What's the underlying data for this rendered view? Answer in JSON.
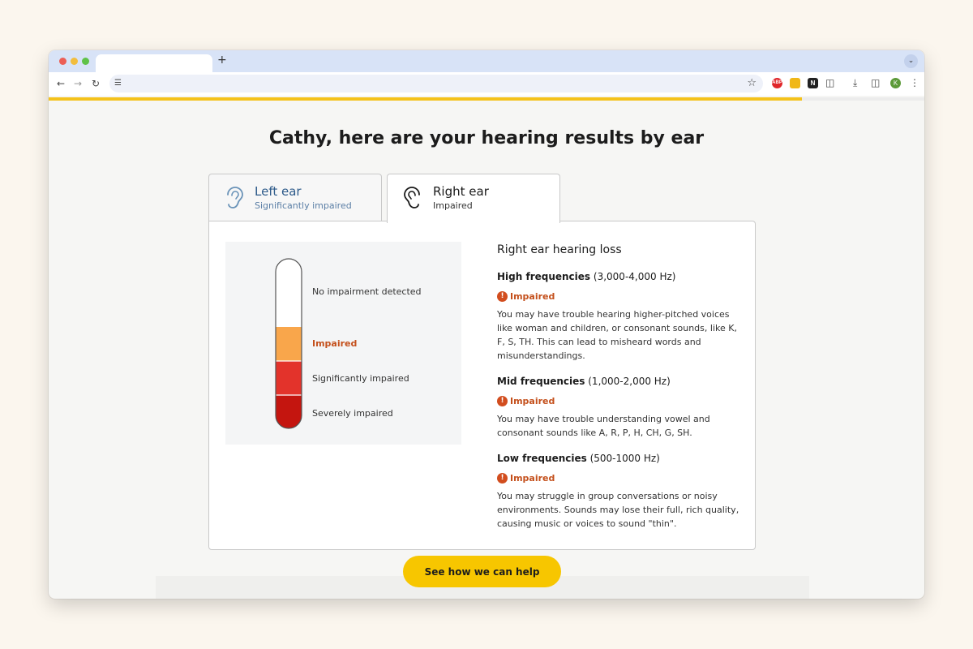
{
  "browser": {
    "new_tab_symbol": "+",
    "tab_menu_icon": "chevron-down-icon",
    "extensions": [
      {
        "name": "adblock-extension-icon",
        "label": "ABP",
        "color": "#e0262a"
      },
      {
        "name": "yellow-extension-icon",
        "label": "",
        "color": "#f0b718"
      },
      {
        "name": "notion-extension-icon",
        "label": "N",
        "color": "#222222"
      }
    ],
    "profile_initial": "K",
    "progress_fraction": 0.86
  },
  "page": {
    "heading": "Cathy, here are your hearing results by ear",
    "cta_label": "See how we can help"
  },
  "ear_tabs": [
    {
      "name": "Left ear",
      "status": "Significantly impaired",
      "selected": false
    },
    {
      "name": "Right ear",
      "status": "Impaired",
      "selected": true
    }
  ],
  "scale": {
    "labels": [
      "No impairment detected",
      "Impaired",
      "Significantly impaired",
      "Severely impaired"
    ],
    "active_index": 1,
    "colors": [
      "#ffffff",
      "#f9a64b",
      "#e3332b",
      "#c4150f"
    ]
  },
  "details": {
    "title": "Right ear hearing loss",
    "frequencies": [
      {
        "label": "High frequencies",
        "range": "(3,000-4,000 Hz)",
        "status": "Impaired",
        "description": "You may have trouble hearing higher-pitched voices like woman and children, or consonant sounds, like K, F, S, TH. This can lead to misheard words and misunderstandings."
      },
      {
        "label": "Mid frequencies",
        "range": "(1,000-2,000 Hz)",
        "status": "Impaired",
        "description": "You may have trouble understanding vowel and consonant sounds like A, R, P, H, CH, G, SH."
      },
      {
        "label": "Low frequencies",
        "range": "(500-1000 Hz)",
        "status": "Impaired",
        "description": "You may struggle in group conversations or noisy environments. Sounds may lose their full, rich quality, causing music or voices to sound \"thin\"."
      }
    ]
  },
  "colors": {
    "accent_yellow": "#f7c600",
    "progress_yellow": "#f4c21b",
    "impaired_orange": "#c4501c",
    "left_ear_blue": "#2d5a8a"
  }
}
